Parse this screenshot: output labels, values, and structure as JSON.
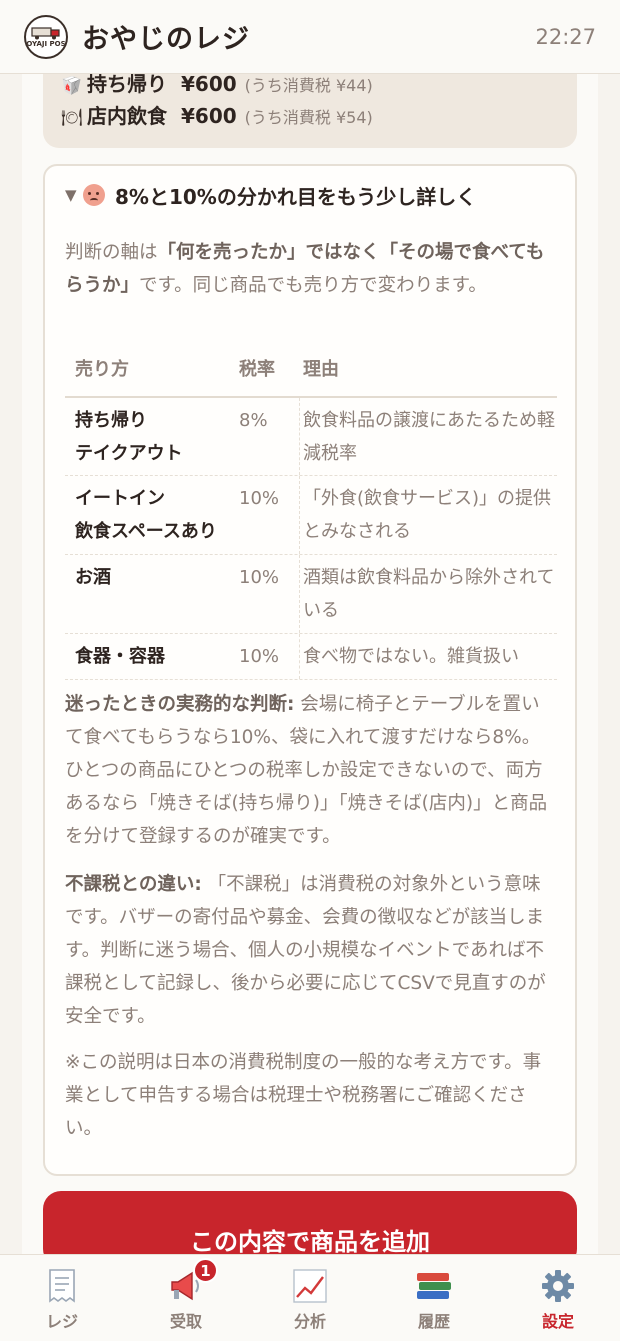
{
  "header": {
    "title": "おやじのレジ",
    "time": "22:27",
    "logo_text": "OYAJI POS"
  },
  "price": {
    "takeout": {
      "label": "持ち帰り",
      "value": "¥600",
      "tax": "(うち消費税 ¥44)"
    },
    "eatin": {
      "label": "店内飲食",
      "value": "¥600",
      "tax": "(うち消費税 ¥54)"
    }
  },
  "details": {
    "summary": "8%と10%の分かれ目をもう少し詳しく",
    "intro_a": "判断の軸は",
    "intro_b": "「何を売ったか」ではなく「その場で食べてもらうか」",
    "intro_c": "です。同じ商品でも売り方で変わります。",
    "table": {
      "headers": [
        "売り方",
        "税率",
        "理由"
      ],
      "rows": [
        {
          "method": [
            "持ち帰り",
            "テイクアウト"
          ],
          "rate": "8%",
          "reason": "飲食料品の譲渡にあたるため軽減税率"
        },
        {
          "method": [
            "イートイン",
            "飲食スペースあり"
          ],
          "rate": "10%",
          "reason": "「外食(飲食サービス)」の提供とみなされる"
        },
        {
          "method": [
            "お酒",
            ""
          ],
          "rate": "10%",
          "reason": "酒類は飲食料品から除外されている"
        },
        {
          "method": [
            "食器・容器",
            ""
          ],
          "rate": "10%",
          "reason": "食べ物ではない。雑貨扱い"
        }
      ]
    },
    "practical_title": "迷ったときの実務的な判断:",
    "practical_body": " 会場に椅子とテーブルを置いて食べてもらうなら10%、袋に入れて渡すだけなら8%。ひとつの商品にひとつの税率しか設定できないので、両方あるなら「焼きそば(持ち帰り)」「焼きそば(店内)」と商品を分けて登録するのが確実です。",
    "nontax_title": "不課税との違い:",
    "nontax_body": " 「不課税」は消費税の対象外という意味です。バザーの寄付品や募金、会費の徴収などが該当します。判断に迷う場合、個人の小規模なイベントであれば不課税として記録し、後から必要に応じてCSVで見直すのが安全です。",
    "note": "※この説明は日本の消費税制度の一般的な考え方です。事業として申告する場合は税理士や税務署にご確認ください。"
  },
  "cta": {
    "label": "この内容で商品を追加"
  },
  "nav": {
    "items": [
      {
        "label": "レジ",
        "icon": "receipt-icon"
      },
      {
        "label": "受取",
        "icon": "megaphone-icon",
        "badge": "1"
      },
      {
        "label": "分析",
        "icon": "chart-icon"
      },
      {
        "label": "履歴",
        "icon": "books-icon"
      },
      {
        "label": "設定",
        "icon": "gear-icon",
        "active": true
      }
    ]
  },
  "colors": {
    "accent": "#c8252c",
    "muted_text": "#8d8079",
    "card_bg": "#efe8df"
  }
}
